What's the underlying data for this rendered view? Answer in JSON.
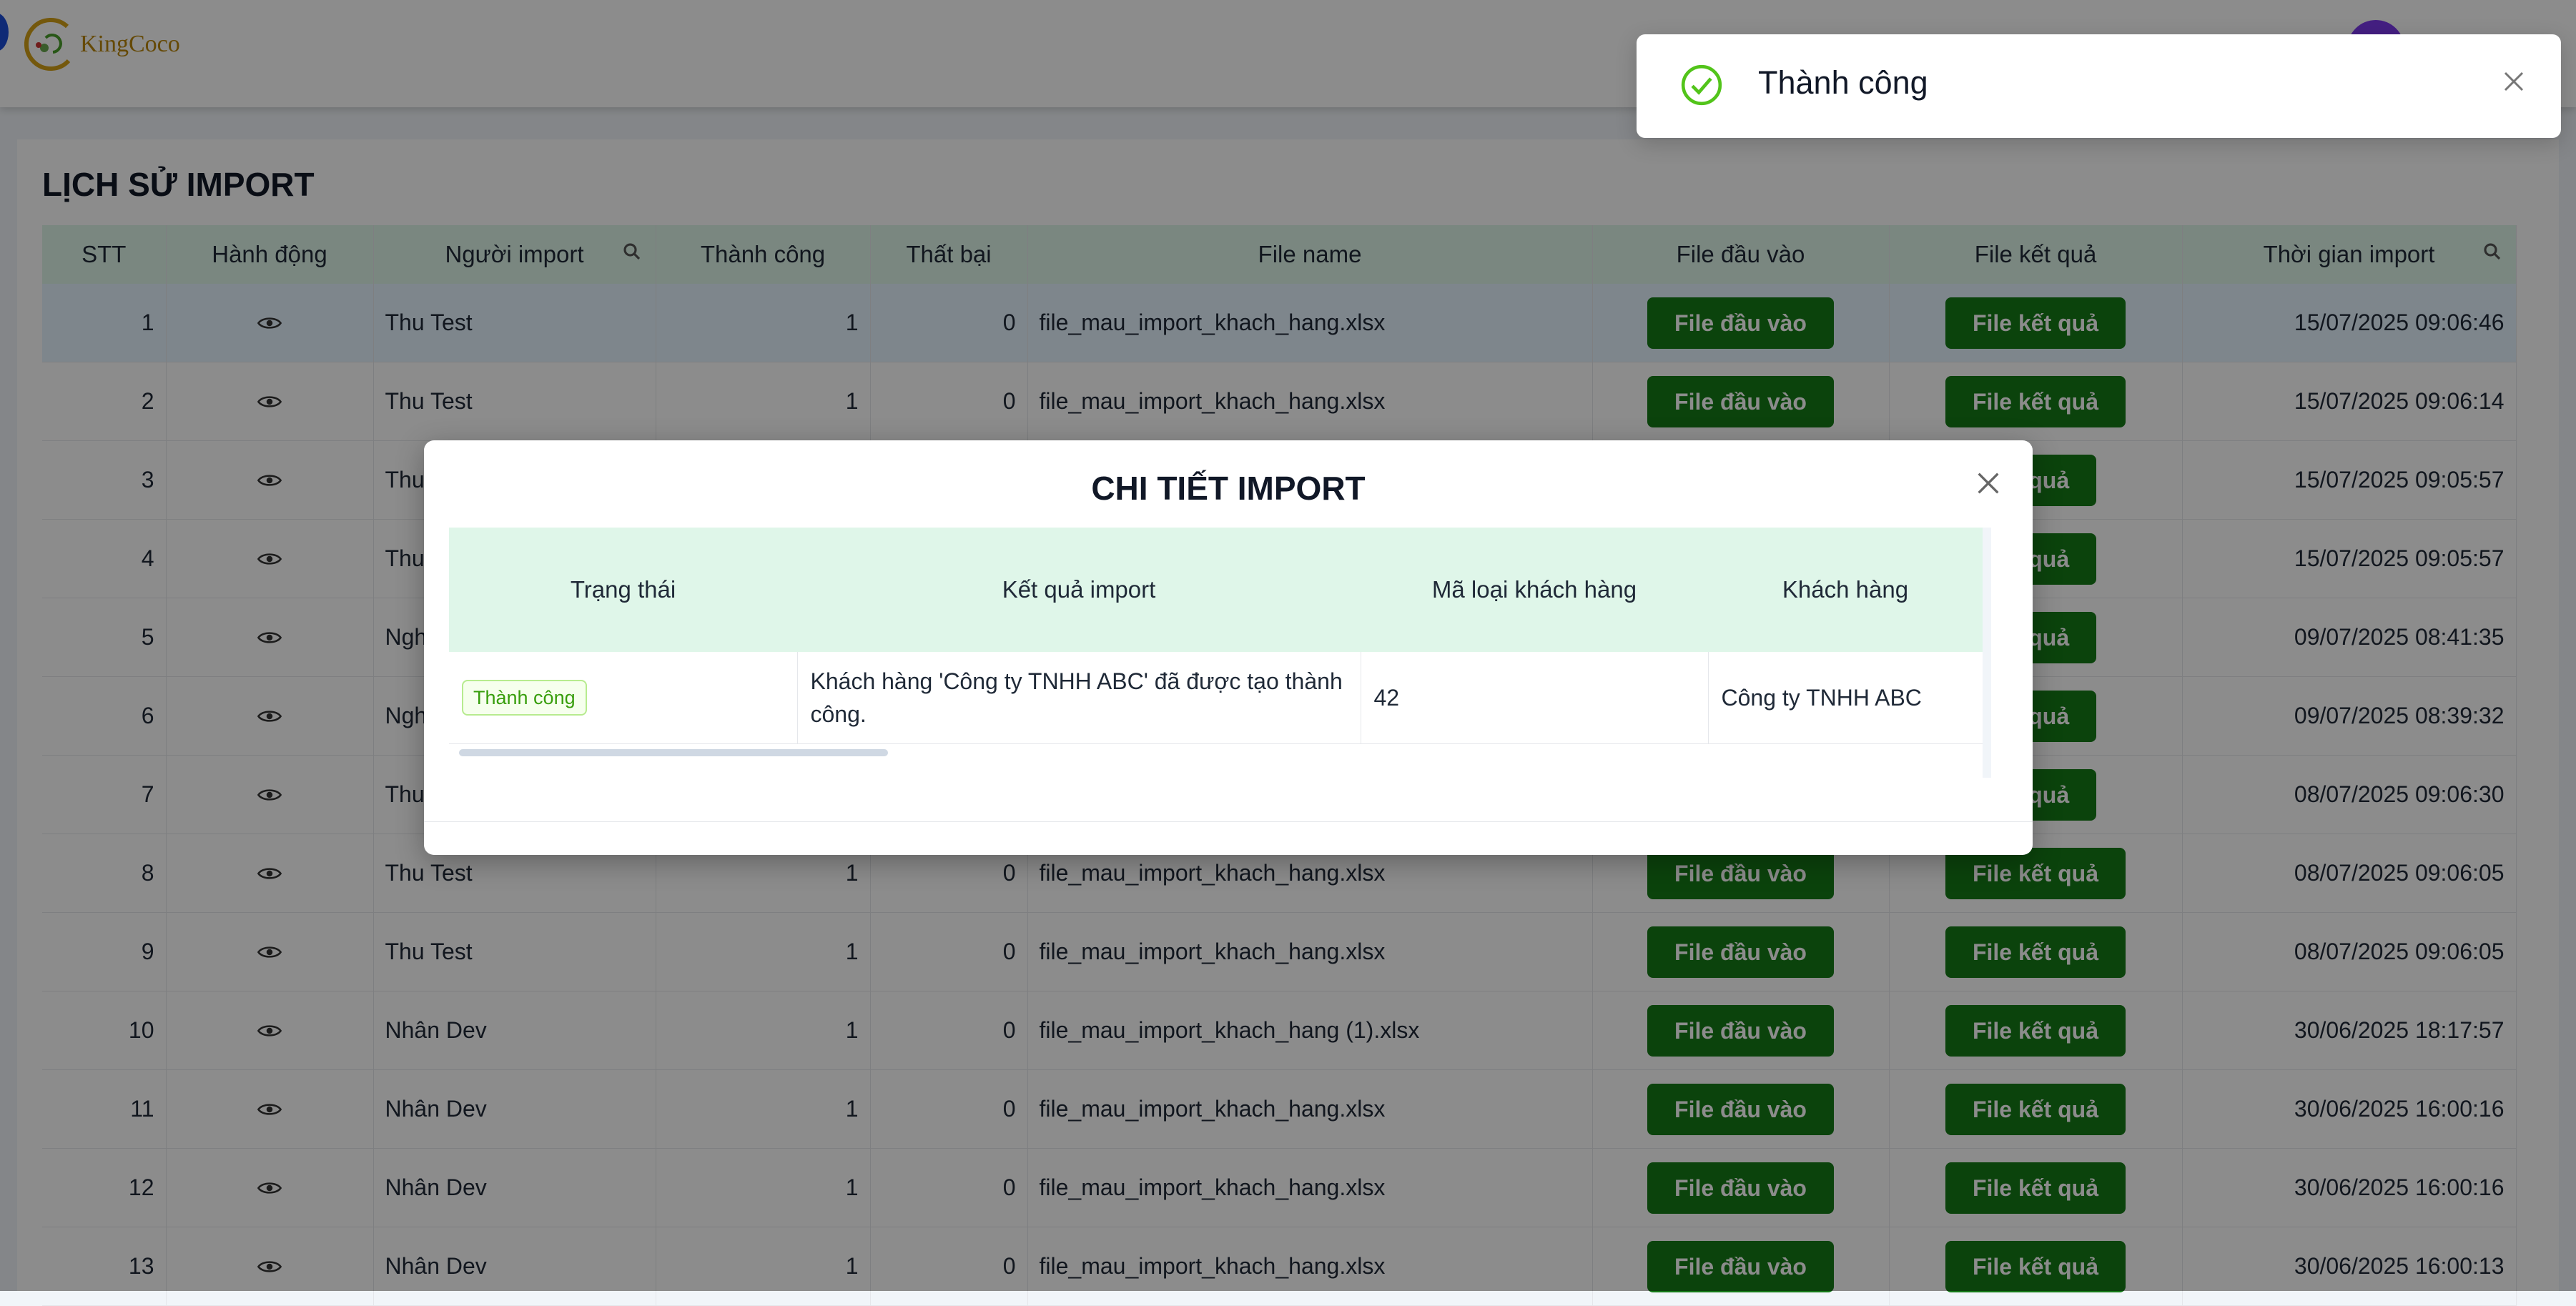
{
  "brand": {
    "name": "KingCoco"
  },
  "page": {
    "title": "LỊCH SỬ IMPORT"
  },
  "table": {
    "columns": [
      "STT",
      "Hành động",
      "Người import",
      "Thành công",
      "Thất bại",
      "File name",
      "File đầu vào",
      "File kết quả",
      "Thời gian import"
    ],
    "rows": [
      {
        "stt": "1",
        "user": "Thu Test",
        "success": "1",
        "fail": "0",
        "file": "file_mau_import_khach_hang.xlsx",
        "input_btn": "File đầu vào",
        "result_btn": "File kết quả",
        "time": "15/07/2025 09:06:46"
      },
      {
        "stt": "2",
        "user": "Thu Test",
        "success": "1",
        "fail": "0",
        "file": "file_mau_import_khach_hang.xlsx",
        "input_btn": "File đầu vào",
        "result_btn": "File kết quả",
        "time": "15/07/2025 09:06:14"
      },
      {
        "stt": "3",
        "user": "Thu",
        "success": "",
        "fail": "",
        "file": "",
        "input_btn": "",
        "result_btn": "ết quả",
        "time": "15/07/2025 09:05:57"
      },
      {
        "stt": "4",
        "user": "Thu",
        "success": "",
        "fail": "",
        "file": "",
        "input_btn": "",
        "result_btn": "ết quả",
        "time": "15/07/2025 09:05:57"
      },
      {
        "stt": "5",
        "user": "Ngh",
        "success": "",
        "fail": "",
        "file": "",
        "input_btn": "",
        "result_btn": "ết quả",
        "time": "09/07/2025 08:41:35"
      },
      {
        "stt": "6",
        "user": "Ngh",
        "success": "",
        "fail": "",
        "file": "",
        "input_btn": "",
        "result_btn": "ết quả",
        "time": "09/07/2025 08:39:32"
      },
      {
        "stt": "7",
        "user": "Thu",
        "success": "",
        "fail": "",
        "file": "",
        "input_btn": "",
        "result_btn": "ết quả",
        "time": "08/07/2025 09:06:30"
      },
      {
        "stt": "8",
        "user": "Thu Test",
        "success": "1",
        "fail": "0",
        "file": "file_mau_import_khach_hang.xlsx",
        "input_btn": "File đầu vào",
        "result_btn": "File kết quả",
        "time": "08/07/2025 09:06:05"
      },
      {
        "stt": "9",
        "user": "Thu Test",
        "success": "1",
        "fail": "0",
        "file": "file_mau_import_khach_hang.xlsx",
        "input_btn": "File đầu vào",
        "result_btn": "File kết quả",
        "time": "08/07/2025 09:06:05"
      },
      {
        "stt": "10",
        "user": "Nhân Dev",
        "success": "1",
        "fail": "0",
        "file": "file_mau_import_khach_hang (1).xlsx",
        "input_btn": "File đầu vào",
        "result_btn": "File kết quả",
        "time": "30/06/2025 18:17:57"
      },
      {
        "stt": "11",
        "user": "Nhân Dev",
        "success": "1",
        "fail": "0",
        "file": "file_mau_import_khach_hang.xlsx",
        "input_btn": "File đầu vào",
        "result_btn": "File kết quả",
        "time": "30/06/2025 16:00:16"
      },
      {
        "stt": "12",
        "user": "Nhân Dev",
        "success": "1",
        "fail": "0",
        "file": "file_mau_import_khach_hang.xlsx",
        "input_btn": "File đầu vào",
        "result_btn": "File kết quả",
        "time": "30/06/2025 16:00:16"
      },
      {
        "stt": "13",
        "user": "Nhân Dev",
        "success": "1",
        "fail": "0",
        "file": "file_mau_import_khach_hang.xlsx",
        "input_btn": "File đầu vào",
        "result_btn": "File kết quả",
        "time": "30/06/2025 16:00:13"
      }
    ]
  },
  "modal": {
    "title": "CHI TIẾT IMPORT",
    "columns": [
      "Trạng thái",
      "Kết quả import",
      "Mã loại khách hàng",
      "Khách hàng"
    ],
    "row": {
      "status": "Thành công",
      "result": "Khách hàng 'Công ty TNHH ABC' đã được tạo thành công.",
      "customer_type_code": "42",
      "customer": "Công ty TNHH ABC"
    }
  },
  "toast": {
    "message": "Thành công"
  },
  "colors": {
    "primary_green": "#157a17",
    "header_bg": "#dff6e9",
    "success_icon": "#52c41a",
    "selected_row": "#e6f4ff"
  }
}
